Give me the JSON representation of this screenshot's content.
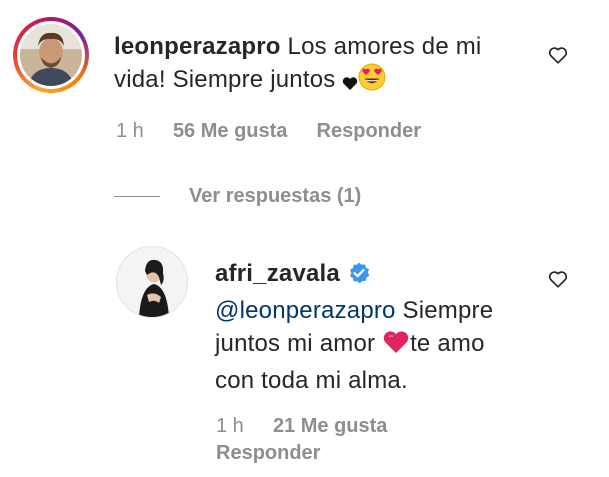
{
  "comment": {
    "username": "leonperazapro",
    "text_line1": "Los amores de mi",
    "text_line2": "vida! Siempre juntos",
    "time": "1 h",
    "likes": "56 Me gusta",
    "reply": "Responder"
  },
  "replies_toggle": {
    "label": "Ver respuestas (1)"
  },
  "reply_comment": {
    "username": "afri_zavala",
    "mention": "@leonperazapro",
    "text_part1": "Siempre",
    "text_line2a": "juntos mi amor",
    "text_line2b": "te amo",
    "text_line3": "con toda mi alma.",
    "time": "1 h",
    "likes": "21 Me gusta",
    "reply": "Responder"
  },
  "icons": {
    "like": "heart-outline-icon",
    "verified": "verified-badge-icon",
    "small_heart": "black-heart-icon",
    "emoji": "heart-eyes-emoji-icon",
    "red_heart": "red-heart-emoji-icon"
  },
  "colors": {
    "text": "#262626",
    "muted": "#8e8e8e",
    "mention": "#00376b",
    "verified": "#3897f0",
    "red_heart": "#e0245e"
  }
}
